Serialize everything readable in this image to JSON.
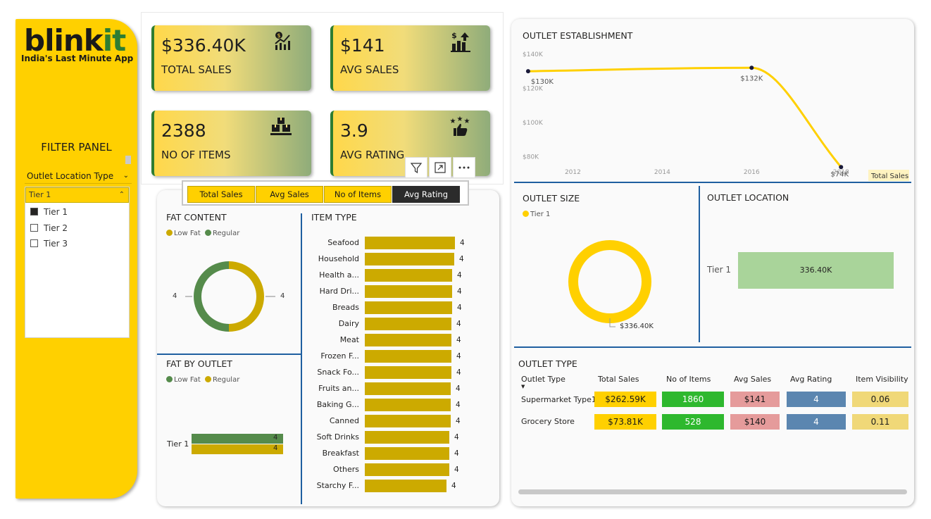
{
  "brand": {
    "logo_main": "blink",
    "logo_accent": "it",
    "tagline": "India's Last Minute App"
  },
  "filter": {
    "title": "FILTER PANEL",
    "slicer_label": "Outlet Location Type",
    "selected": "Tier 1",
    "items": [
      {
        "label": "Tier 1",
        "checked": true
      },
      {
        "label": "Tier 2",
        "checked": false
      },
      {
        "label": "Tier 3",
        "checked": false
      }
    ]
  },
  "kpis": [
    {
      "value": "$336.40K",
      "label": "TOTAL SALES",
      "icon": "sales-chart-icon"
    },
    {
      "value": "$141",
      "label": "AVG SALES",
      "icon": "dollar-bars-icon"
    },
    {
      "value": "2388",
      "label": "NO OF ITEMS",
      "icon": "boxes-icon"
    },
    {
      "value": "3.9",
      "label": "AVG RATING",
      "icon": "stars-thumb-icon"
    }
  ],
  "measure_buttons": {
    "total_sales": "Total Sales",
    "avg_sales": "Avg Sales",
    "no_of_items": "No of Items",
    "avg_rating": "Avg Rating",
    "active": "Avg Rating"
  },
  "fat_content": {
    "title": "FAT CONTENT",
    "legend": [
      "Low Fat",
      "Regular"
    ],
    "colors": [
      "#CCAA00",
      "#558B4B"
    ],
    "left_label": "4",
    "right_label": "4"
  },
  "fat_by_outlet": {
    "title": "FAT BY OUTLET",
    "legend": [
      "Low Fat",
      "Regular"
    ],
    "category": "Tier 1",
    "values": [
      "4",
      "4"
    ]
  },
  "item_type": {
    "title": "ITEM TYPE",
    "bars": [
      {
        "label": "Seafood",
        "value": "4",
        "w": 1.0
      },
      {
        "label": "Household",
        "value": "4",
        "w": 0.99
      },
      {
        "label": "Health a...",
        "value": "4",
        "w": 0.97
      },
      {
        "label": "Hard Dri...",
        "value": "4",
        "w": 0.97
      },
      {
        "label": "Breads",
        "value": "4",
        "w": 0.97
      },
      {
        "label": "Dairy",
        "value": "4",
        "w": 0.96
      },
      {
        "label": "Meat",
        "value": "4",
        "w": 0.96
      },
      {
        "label": "Frozen F...",
        "value": "4",
        "w": 0.96
      },
      {
        "label": "Snack Fo...",
        "value": "4",
        "w": 0.96
      },
      {
        "label": "Fruits an...",
        "value": "4",
        "w": 0.95
      },
      {
        "label": "Baking G...",
        "value": "4",
        "w": 0.95
      },
      {
        "label": "Canned",
        "value": "4",
        "w": 0.95
      },
      {
        "label": "Soft Drinks",
        "value": "4",
        "w": 0.94
      },
      {
        "label": "Breakfast",
        "value": "4",
        "w": 0.94
      },
      {
        "label": "Others",
        "value": "4",
        "w": 0.94
      },
      {
        "label": "Starchy F...",
        "value": "4",
        "w": 0.91
      }
    ]
  },
  "chart_data": {
    "type": "line",
    "title": "OUTLET ESTABLISHMENT",
    "x": [
      2011,
      2016,
      2018
    ],
    "values": [
      130,
      132,
      74
    ],
    "point_labels": [
      "$130K",
      "$132K",
      "$74K"
    ],
    "x_ticks": [
      "2012",
      "2014",
      "2016",
      "2018"
    ],
    "y_ticks": [
      "$140K",
      "$120K",
      "$100K",
      "$80K"
    ],
    "ylim": [
      70,
      142
    ],
    "xlim": [
      2011.6,
      2018.5
    ],
    "series_name": "Total Sales",
    "color": "#FFD000"
  },
  "outlet_size": {
    "title": "OUTLET SIZE",
    "legend": "Tier 1",
    "value": "$336.40K",
    "color": "#FFD000"
  },
  "outlet_location": {
    "title": "OUTLET LOCATION",
    "category": "Tier 1",
    "value": "336.40K",
    "color": "#A9D49A"
  },
  "outlet_type": {
    "title": "OUTLET TYPE",
    "headers": [
      "Outlet Type",
      "Total Sales",
      "No of Items",
      "Avg Sales",
      "Avg Rating",
      "Item Visibility"
    ],
    "rows": [
      [
        "Supermarket Type1",
        "$262.59K",
        "1860",
        "$141",
        "4",
        "0.06"
      ],
      [
        "Grocery Store",
        "$73.81K",
        "528",
        "$140",
        "4",
        "0.11"
      ]
    ],
    "col_colors": [
      "#FFD000",
      "#2EB82E",
      "#E59B9B",
      "#5B86B0",
      "#F0D878"
    ]
  }
}
